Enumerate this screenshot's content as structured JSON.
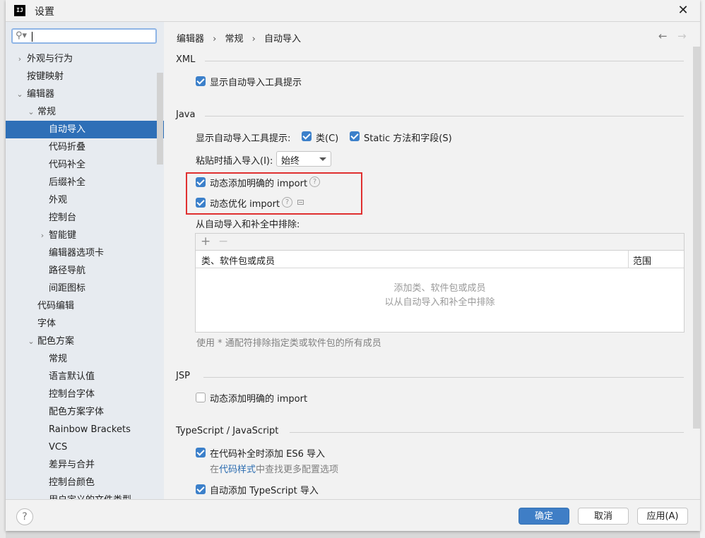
{
  "window": {
    "title": "设置",
    "logo_text": "IJ"
  },
  "search": {
    "placeholder": "",
    "value": ""
  },
  "sidebar": {
    "items": [
      {
        "label": "外观与行为",
        "level": 0,
        "arrow": "›",
        "selected": false
      },
      {
        "label": "按键映射",
        "level": 0,
        "arrow": "",
        "selected": false
      },
      {
        "label": "编辑器",
        "level": 0,
        "arrow": "⌄",
        "selected": false
      },
      {
        "label": "常规",
        "level": 1,
        "arrow": "⌄",
        "selected": false
      },
      {
        "label": "自动导入",
        "level": 2,
        "arrow": "",
        "selected": true
      },
      {
        "label": "代码折叠",
        "level": 2,
        "arrow": "",
        "selected": false
      },
      {
        "label": "代码补全",
        "level": 2,
        "arrow": "",
        "selected": false
      },
      {
        "label": "后缀补全",
        "level": 2,
        "arrow": "",
        "selected": false
      },
      {
        "label": "外观",
        "level": 2,
        "arrow": "",
        "selected": false
      },
      {
        "label": "控制台",
        "level": 2,
        "arrow": "",
        "selected": false
      },
      {
        "label": "智能键",
        "level": 2,
        "arrow": "›",
        "selected": false
      },
      {
        "label": "编辑器选项卡",
        "level": 2,
        "arrow": "",
        "selected": false
      },
      {
        "label": "路径导航",
        "level": 2,
        "arrow": "",
        "selected": false
      },
      {
        "label": "间距图标",
        "level": 2,
        "arrow": "",
        "selected": false
      },
      {
        "label": "代码编辑",
        "level": 1,
        "arrow": "",
        "selected": false
      },
      {
        "label": "字体",
        "level": 1,
        "arrow": "",
        "selected": false
      },
      {
        "label": "配色方案",
        "level": 1,
        "arrow": "⌄",
        "selected": false
      },
      {
        "label": "常规",
        "level": 2,
        "arrow": "",
        "selected": false
      },
      {
        "label": "语言默认值",
        "level": 2,
        "arrow": "",
        "selected": false
      },
      {
        "label": "控制台字体",
        "level": 2,
        "arrow": "",
        "selected": false
      },
      {
        "label": "配色方案字体",
        "level": 2,
        "arrow": "",
        "selected": false
      },
      {
        "label": "Rainbow Brackets",
        "level": 2,
        "arrow": "",
        "selected": false
      },
      {
        "label": "VCS",
        "level": 2,
        "arrow": "",
        "selected": false
      },
      {
        "label": "差异与合并",
        "level": 2,
        "arrow": "",
        "selected": false
      },
      {
        "label": "控制台颜色",
        "level": 2,
        "arrow": "",
        "selected": false
      },
      {
        "label": "用户定义的文件类型",
        "level": 2,
        "arrow": "",
        "selected": false
      }
    ]
  },
  "breadcrumb": {
    "items": [
      "编辑器",
      "常规",
      "自动导入"
    ],
    "separator": "›"
  },
  "nav": {
    "back": "←",
    "forward": "→"
  },
  "xml": {
    "title": "XML",
    "show_tooltip": {
      "label": "显示自动导入工具提示",
      "checked": true
    }
  },
  "java": {
    "title": "Java",
    "show_tooltip_label": "显示自动导入工具提示:",
    "class_cb": {
      "label": "类(C)",
      "checked": true
    },
    "static_cb": {
      "label": "Static 方法和字段(S)",
      "checked": true
    },
    "paste_label": "粘贴时插入导入(I):",
    "paste_value": "始终",
    "add_unambiguous": {
      "label": "动态添加明确的 import",
      "checked": true
    },
    "optimize": {
      "label": "动态优化 import",
      "checked": true
    },
    "exclude_label": "从自动导入和补全中排除:",
    "table": {
      "add": "+",
      "remove": "−",
      "columns": [
        "类、软件包或成员",
        "范围"
      ],
      "empty_line1": "添加类、软件包或成员",
      "empty_line2": "以从自动导入和补全中排除"
    },
    "hint": "使用 * 通配符排除指定类或软件包的所有成员"
  },
  "jsp": {
    "title": "JSP",
    "add_unambiguous": {
      "label": "动态添加明确的 import",
      "checked": false
    }
  },
  "ts": {
    "title": "TypeScript / JavaScript",
    "es6": {
      "label": "在代码补全时添加 ES6 导入",
      "checked": true
    },
    "hint_prefix": "在",
    "hint_link": "代码样式",
    "hint_suffix": "中查找更多配置选项",
    "auto_ts": {
      "label": "自动添加 TypeScript 导入",
      "checked": true
    }
  },
  "footer": {
    "help": "?",
    "ok": "确定",
    "cancel": "取消",
    "apply": "应用(A)"
  },
  "colors": {
    "accent": "#3c80ca",
    "selection": "#2e6fb7",
    "highlight_box": "#e03030"
  }
}
